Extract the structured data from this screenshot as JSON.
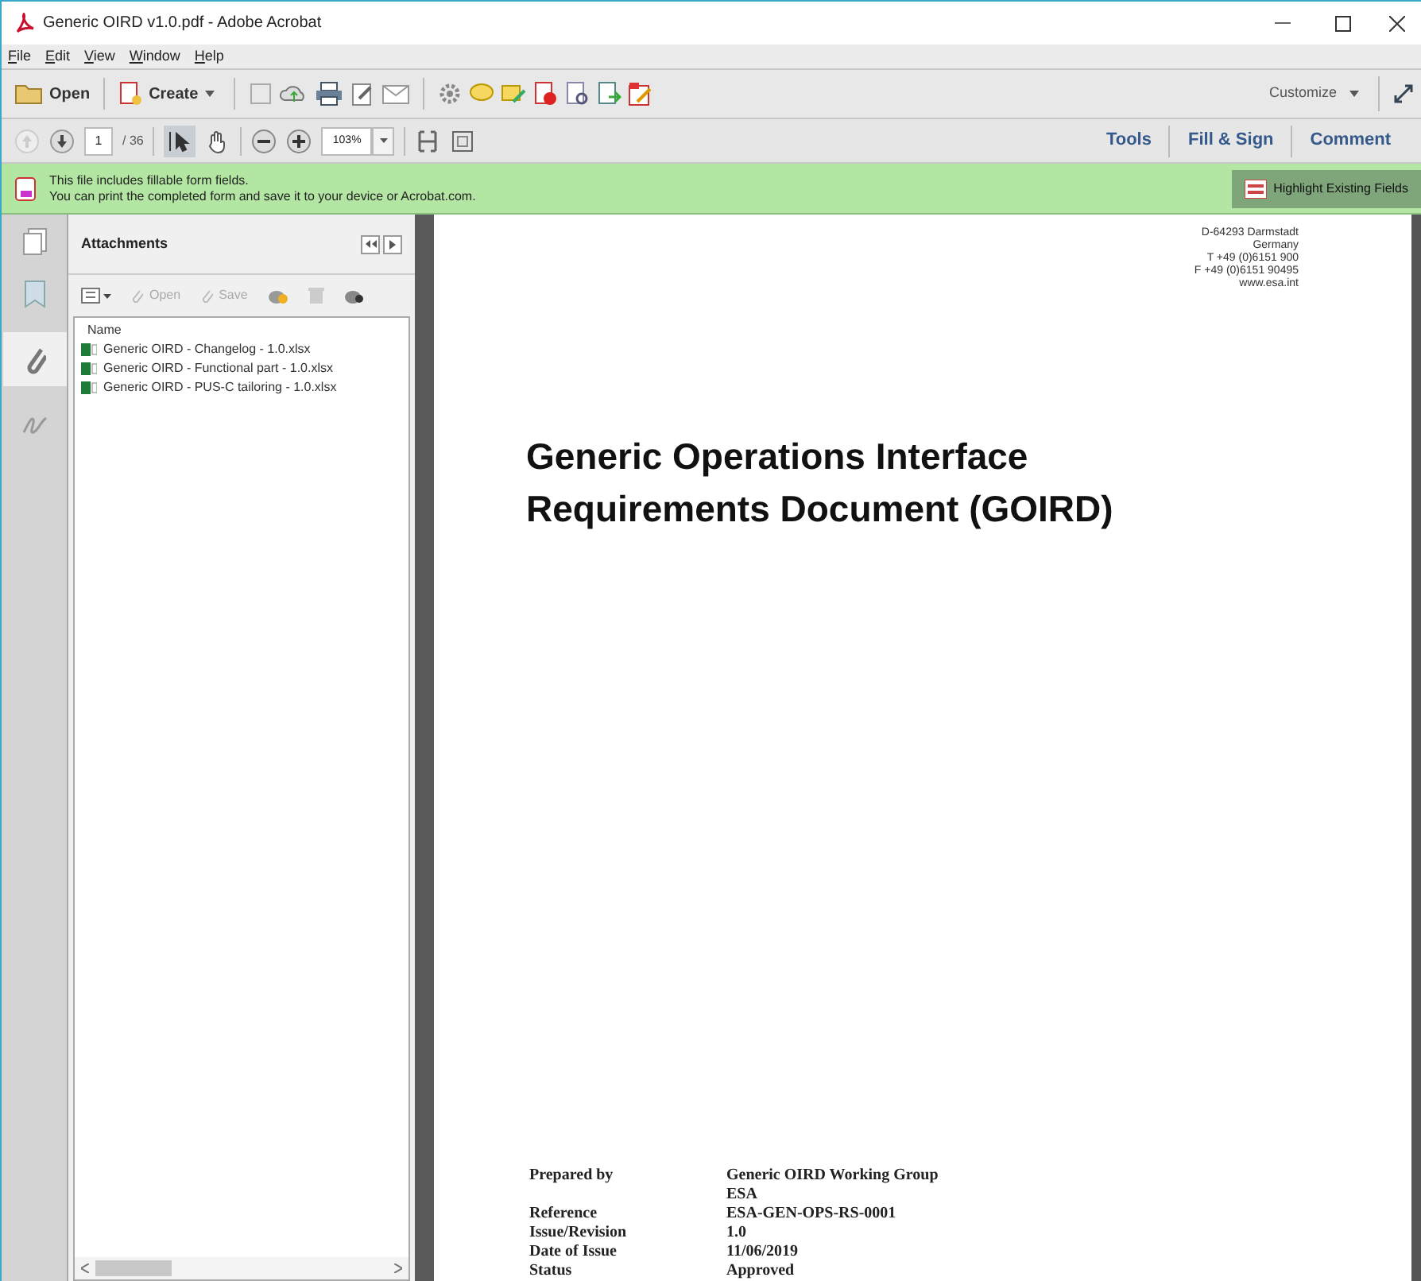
{
  "window": {
    "title": "Generic OIRD v1.0.pdf - Adobe Acrobat"
  },
  "menu": [
    {
      "label": "File"
    },
    {
      "label": "Edit"
    },
    {
      "label": "View"
    },
    {
      "label": "Window"
    },
    {
      "label": "Help"
    }
  ],
  "toolbar": {
    "open": "Open",
    "create": "Create",
    "customize": "Customize"
  },
  "nav": {
    "page": "1",
    "total": "/ 36",
    "zoom": "103%"
  },
  "panes": [
    {
      "label": "Tools"
    },
    {
      "label": "Fill & Sign"
    },
    {
      "label": "Comment"
    }
  ],
  "notice": {
    "lines": [
      "This file includes fillable form fields.",
      "You can print the completed form and save it to your device or Acrobat.com."
    ],
    "button": "Highlight Existing Fields"
  },
  "attachments": {
    "title": "Attachments",
    "actions": [
      {
        "label": "Open",
        "disabled": true
      },
      {
        "label": "Save",
        "disabled": true
      }
    ],
    "column": "Name",
    "files": [
      {
        "name": "Generic OIRD - Changelog - 1.0.xlsx"
      },
      {
        "name": "Generic OIRD - Functional part - 1.0.xlsx"
      },
      {
        "name": "Generic OIRD - PUS-C tailoring - 1.0.xlsx"
      }
    ]
  },
  "document": {
    "address": [
      "D-64293 Darmstadt",
      "Germany",
      "T +49 (0)6151 900",
      "F +49 (0)6151 90495",
      "www.esa.int"
    ],
    "title": [
      "Generic Operations Interface",
      "Requirements Document (GOIRD)"
    ],
    "details": [
      {
        "label": "Prepared by",
        "value": "Generic OIRD Working Group"
      },
      {
        "value": "ESA"
      },
      {
        "label": "Reference",
        "value": "ESA-GEN-OPS-RS-0001"
      },
      {
        "label": "Issue/Revision",
        "value": "1.0"
      },
      {
        "label": "Date of Issue",
        "value": "11/06/2019"
      },
      {
        "label": "Status",
        "value": "Approved"
      }
    ]
  }
}
